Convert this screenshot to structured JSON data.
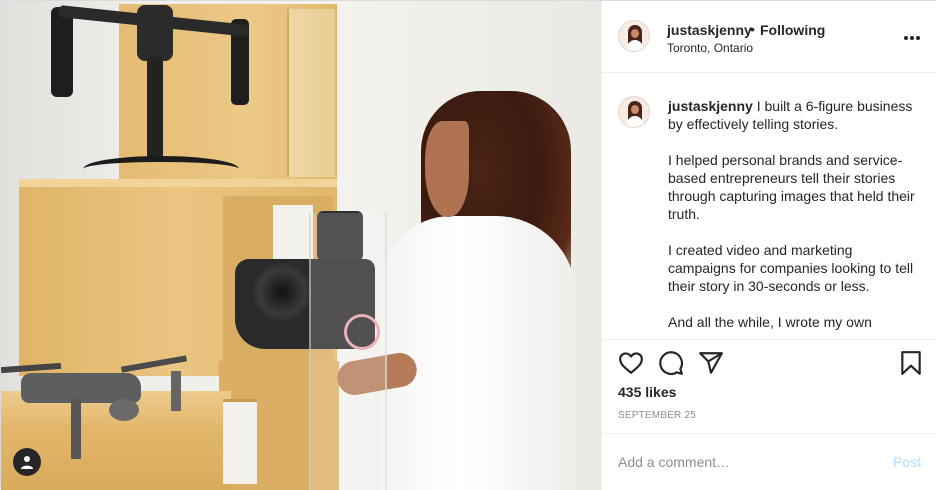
{
  "header": {
    "username": "justaskjenny",
    "separator": "•",
    "follow_status": "Following",
    "location": "Toronto, Ontario"
  },
  "caption": {
    "username": "justaskjenny",
    "paragraphs": [
      "I built a 6-figure business by effectively telling stories.",
      "I helped personal brands and service-based entrepreneurs tell their stories through capturing images that held their truth.",
      "I created video and marketing campaigns for companies looking to tell their story in 30-seconds or less.",
      "And all the while, I wrote my own"
    ]
  },
  "actions": {
    "icons": [
      "heart-icon",
      "comment-icon",
      "share-icon",
      "bookmark-icon"
    ]
  },
  "likes": "435 likes",
  "date": "SEPTEMBER 25",
  "comment": {
    "placeholder": "Add a comment…",
    "post_label": "Post"
  },
  "colors": {
    "text": "#262626",
    "secondary": "#8e8e8e",
    "post_disabled": "#b2dffc",
    "border": "#efefef"
  }
}
